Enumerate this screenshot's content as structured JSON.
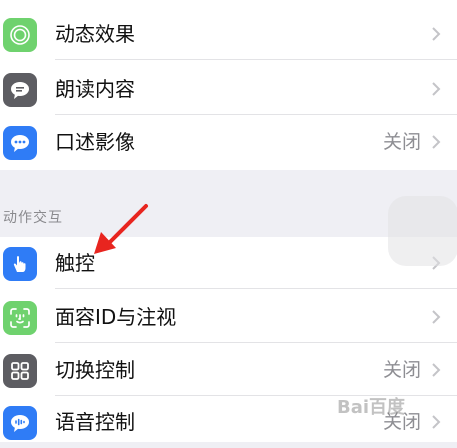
{
  "colors": {
    "motion_icon_bg": "#6fd26e",
    "spoken_icon_bg": "#5d5d62",
    "audiodesc_icon_bg": "#2f7cf6",
    "touch_icon_bg": "#2f7cf6",
    "faceid_icon_bg": "#6fd26e",
    "switch_icon_bg": "#5d5d62",
    "voice_icon_bg": "#2f7cf6",
    "annotation_arrow": "#e8251f"
  },
  "group1": {
    "rows": [
      {
        "label": "动态效果",
        "icon": "motion-icon"
      },
      {
        "label": "朗读内容",
        "icon": "speech-bubble-icon"
      },
      {
        "label": "口述影像",
        "value": "关闭",
        "icon": "audio-description-icon"
      }
    ]
  },
  "section_header": "动作交互",
  "group2": {
    "rows": [
      {
        "label": "触控",
        "icon": "hand-touch-icon"
      },
      {
        "label": "面容ID与注视",
        "icon": "face-id-icon"
      },
      {
        "label": "切换控制",
        "value": "关闭",
        "icon": "switch-control-icon"
      },
      {
        "label": "语音控制",
        "value": "关闭",
        "icon": "voice-control-icon"
      }
    ]
  },
  "watermark": "Bai百度"
}
